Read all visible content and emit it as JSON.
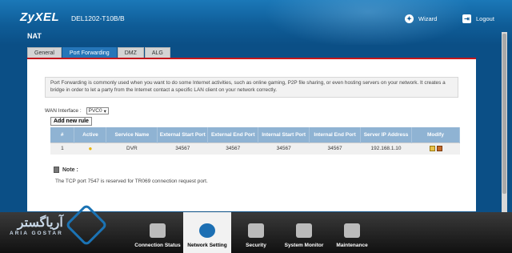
{
  "header": {
    "brand": "ZyXEL",
    "model": "DEL1202-T10B/B",
    "page_title": "NAT",
    "wizard_label": "Wizard",
    "logout_label": "Logout"
  },
  "tabs": [
    {
      "label": "General",
      "active": false
    },
    {
      "label": "Port Forwarding",
      "active": true
    },
    {
      "label": "DMZ",
      "active": false
    },
    {
      "label": "ALG",
      "active": false
    }
  ],
  "info_text": "Port Forwarding is commonly used when you want to do some Internet activities, such as online gaming, P2P file sharing, or even hosting servers on your network. It creates a bridge in order to let a party from the Internet contact a specific LAN client on your network correctly.",
  "wan": {
    "label": "WAN Interface :",
    "selected": "PVC0"
  },
  "add_button": "Add new rule",
  "table": {
    "headers": [
      "#",
      "Active",
      "Service Name",
      "External Start Port",
      "External End Port",
      "Internal Start Port",
      "Internal End Port",
      "Server IP Address",
      "Modify"
    ],
    "rows": [
      {
        "num": "1",
        "service": "DVR",
        "ext_start": "34567",
        "ext_end": "34567",
        "int_start": "34567",
        "int_end": "34567",
        "ip": "192.168.1.10"
      }
    ]
  },
  "note": {
    "title": "Note :",
    "text": "The TCP port 7547 is reserved for TR069 connection request port."
  },
  "nav": [
    {
      "label": "Connection Status",
      "icon": "monitor-icon"
    },
    {
      "label": "Network Setting",
      "icon": "globe-icon",
      "active": true
    },
    {
      "label": "Security",
      "icon": "shield-icon"
    },
    {
      "label": "System Monitor",
      "icon": "chart-icon"
    },
    {
      "label": "Maintenance",
      "icon": "tools-icon"
    }
  ],
  "watermark": {
    "persian": "آریاگستر",
    "english": "ARIA GOSTAR"
  },
  "colors": {
    "header_blue": "#0f5d98",
    "active_tab": "#2576b9",
    "table_header": "#8fb3d3",
    "accent_red": "#c4161c"
  }
}
